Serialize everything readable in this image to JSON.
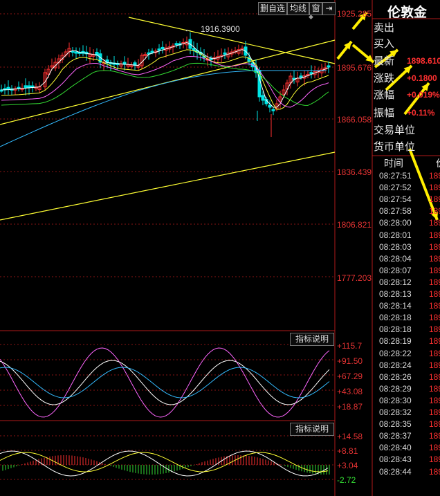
{
  "toolbar": {
    "delete_label": "删自选",
    "ma_label": "均线",
    "window_label": "窗",
    "pin_label": "◆",
    "arrow_label": "⇥"
  },
  "price_axis": [
    "1925.285",
    "1895.676",
    "1866.058",
    "1836.439",
    "1806.821",
    "1777.203"
  ],
  "high_annotation": "1916.3900",
  "indicator1": {
    "button": "指标说明",
    "axis": [
      "+115.7",
      "+91.50",
      "+67.29",
      "+43.08",
      "+18.87"
    ]
  },
  "indicator2": {
    "button": "指标说明",
    "axis": [
      "+14.58",
      "+8.81",
      "+3.04",
      "-2.72"
    ]
  },
  "panel": {
    "title": "伦敦金",
    "rows": [
      {
        "label": "卖出",
        "value": ""
      },
      {
        "label": "买入",
        "value": ""
      },
      {
        "label": "最新",
        "value": "1898.6100"
      },
      {
        "label": "涨跌",
        "value": "+0.1800"
      },
      {
        "label": "涨幅",
        "value": "+0.019%"
      },
      {
        "label": "振幅",
        "value": "+0.11%"
      },
      {
        "label": "交易单位",
        "value": ""
      },
      {
        "label": "货币单位",
        "value": ""
      }
    ],
    "ticks_header": {
      "time": "时间",
      "price": "价"
    },
    "ticks": [
      {
        "time": "08:27:51",
        "price": "189"
      },
      {
        "time": "08:27:52",
        "price": "189"
      },
      {
        "time": "08:27:54",
        "price": "189"
      },
      {
        "time": "08:27:58",
        "price": "189"
      },
      {
        "time": "08:28:00",
        "price": "189"
      },
      {
        "time": "08:28:01",
        "price": "189"
      },
      {
        "time": "08:28:03",
        "price": "189"
      },
      {
        "time": "08:28:04",
        "price": "189"
      },
      {
        "time": "08:28:07",
        "price": "189"
      },
      {
        "time": "08:28:12",
        "price": "189"
      },
      {
        "time": "08:28:13",
        "price": "189"
      },
      {
        "time": "08:28:14",
        "price": "189"
      },
      {
        "time": "08:28:18",
        "price": "189"
      },
      {
        "time": "08:28:18",
        "price": "189"
      },
      {
        "time": "08:28:19",
        "price": "189"
      },
      {
        "time": "08:28:22",
        "price": "189"
      },
      {
        "time": "08:28:24",
        "price": "189"
      },
      {
        "time": "08:28:26",
        "price": "189"
      },
      {
        "time": "08:28:29",
        "price": "189"
      },
      {
        "time": "08:28:30",
        "price": "189"
      },
      {
        "time": "08:28:32",
        "price": "189"
      },
      {
        "time": "08:28:35",
        "price": "189"
      },
      {
        "time": "08:28:37",
        "price": "189"
      },
      {
        "time": "08:28:40",
        "price": "189"
      },
      {
        "time": "08:28:43",
        "price": "189"
      },
      {
        "time": "08:28:44",
        "price": "189"
      }
    ]
  },
  "colors": {
    "up": "#ff3030",
    "down": "#00e5e5",
    "grid": "#8a1414",
    "trend": "#ffff33",
    "ma1": "#ffffff",
    "ma2": "#ffff33",
    "ma3": "#ff66ff",
    "ma4": "#33dd33",
    "ma5": "#33bbff"
  }
}
